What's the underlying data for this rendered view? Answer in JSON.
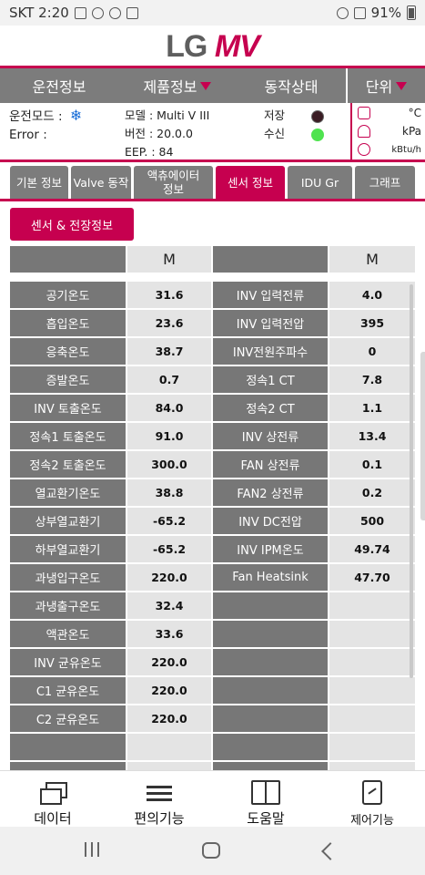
{
  "status_bar": {
    "carrier_time": "SKT 2:20",
    "battery": "91%"
  },
  "logo": {
    "brand": "LG",
    "product": "MV"
  },
  "top_nav": [
    "운전정보",
    "제품정보",
    "동작상태",
    "단위"
  ],
  "info": {
    "mode_label": "운전모드 :",
    "error_label": "Error :",
    "model": "모델 : Multi V III",
    "version": "버전 : 20.0.0",
    "eep": "EEP. : 84",
    "save_label": "저장",
    "receive_label": "수신"
  },
  "units": [
    "°C",
    "kPa",
    "kBtu/h"
  ],
  "tabs": [
    "기본 정보",
    "Valve 동작",
    "액츄에이터\n정보",
    "센서 정보",
    "IDU Gr",
    "그래프"
  ],
  "sensor_button": "센서 & 전장정보",
  "table": {
    "header_left": "M",
    "header_right": "M",
    "rows": [
      [
        "공기온도",
        "31.6",
        "INV 입력전류",
        "4.0"
      ],
      [
        "흡입온도",
        "23.6",
        "INV 입력전압",
        "395"
      ],
      [
        "응축온도",
        "38.7",
        "INV전원주파수",
        "0"
      ],
      [
        "증발온도",
        "0.7",
        "정속1 CT",
        "7.8"
      ],
      [
        "INV 토출온도",
        "84.0",
        "정속2 CT",
        "1.1"
      ],
      [
        "정속1 토출온도",
        "91.0",
        "INV 상전류",
        "13.4"
      ],
      [
        "정속2 토출온도",
        "300.0",
        "FAN 상전류",
        "0.1"
      ],
      [
        "열교환기온도",
        "38.8",
        "FAN2 상전류",
        "0.2"
      ],
      [
        "상부열교환기",
        "-65.2",
        "INV DC전압",
        "500"
      ],
      [
        "하부열교환기",
        "-65.2",
        "INV IPM온도",
        "49.74"
      ],
      [
        "과냉입구온도",
        "220.0",
        "Fan Heatsink",
        "47.70"
      ],
      [
        "과냉출구온도",
        "32.4",
        "",
        ""
      ],
      [
        "액관온도",
        "33.6",
        "",
        ""
      ],
      [
        "INV 균유온도",
        "220.0",
        "",
        ""
      ],
      [
        "C1 균유온도",
        "220.0",
        "",
        ""
      ],
      [
        "C2 균유온도",
        "220.0",
        "",
        ""
      ],
      [
        "",
        "",
        "",
        ""
      ],
      [
        "",
        "",
        "",
        ""
      ]
    ]
  },
  "bottom_nav": [
    "데이터",
    "편의기능",
    "도움말",
    "제어기능"
  ]
}
